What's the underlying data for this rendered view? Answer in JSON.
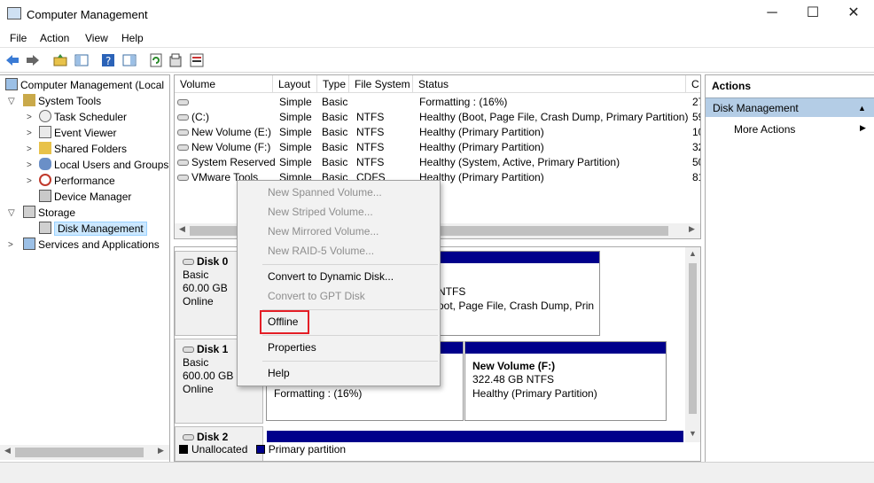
{
  "window": {
    "title": "Computer Management",
    "min": "─",
    "max": "☐",
    "close": "✕"
  },
  "menu": [
    "File",
    "Action",
    "View",
    "Help"
  ],
  "tree": {
    "root": "Computer Management (Local",
    "system_tools": "System Tools",
    "task_scheduler": "Task Scheduler",
    "event_viewer": "Event Viewer",
    "shared_folders": "Shared Folders",
    "local_users": "Local Users and Groups",
    "performance": "Performance",
    "device_manager": "Device Manager",
    "storage": "Storage",
    "disk_management": "Disk Management",
    "services": "Services and Applications"
  },
  "volume_list": {
    "columns": [
      "Volume",
      "Layout",
      "Type",
      "File System",
      "Status",
      "C"
    ],
    "rows": [
      {
        "volume": "",
        "layout": "Simple",
        "type": "Basic",
        "fs": "",
        "status": "Formatting : (16%)",
        "cap": "27"
      },
      {
        "volume": "(C:)",
        "layout": "Simple",
        "type": "Basic",
        "fs": "NTFS",
        "status": "Healthy (Boot, Page File, Crash Dump, Primary Partition)",
        "cap": "59"
      },
      {
        "volume": "New Volume (E:)",
        "layout": "Simple",
        "type": "Basic",
        "fs": "NTFS",
        "status": "Healthy (Primary Partition)",
        "cap": "10"
      },
      {
        "volume": "New Volume (F:)",
        "layout": "Simple",
        "type": "Basic",
        "fs": "NTFS",
        "status": "Healthy (Primary Partition)",
        "cap": "32"
      },
      {
        "volume": "System Reserved",
        "layout": "Simple",
        "type": "Basic",
        "fs": "NTFS",
        "status": "Healthy (System, Active, Primary Partition)",
        "cap": "50"
      },
      {
        "volume": "VMware Tools",
        "layout": "Simple",
        "type": "Basic",
        "fs": "CDFS",
        "status": "Healthy (Primary Partition)",
        "cap": "81"
      }
    ]
  },
  "disks": {
    "disk0": {
      "name": "Disk 0",
      "type": "Basic",
      "size": "60.00 GB",
      "state": "Online",
      "p_fs": "NTFS",
      "p_status": "oot, Page File, Crash Dump, Prin"
    },
    "disk1": {
      "name": "Disk 1",
      "type": "Basic",
      "size": "600.00 GB",
      "state": "Online",
      "p1_status": "Formatting : (16%)",
      "p2_name": "New Volume  (F:)",
      "p2_fs": "322.48 GB NTFS",
      "p2_status": "Healthy (Primary Partition)"
    },
    "disk2": {
      "name": "Disk 2"
    }
  },
  "legend": {
    "unallocated": "Unallocated",
    "primary": "Primary partition"
  },
  "actions": {
    "header": "Actions",
    "section": "Disk Management",
    "more": "More Actions"
  },
  "context_menu": {
    "new_spanned": "New Spanned Volume...",
    "new_striped": "New Striped Volume...",
    "new_mirrored": "New Mirrored Volume...",
    "new_raid5": "New RAID-5 Volume...",
    "convert_dynamic": "Convert to Dynamic Disk...",
    "convert_gpt": "Convert to GPT Disk",
    "offline": "Offline",
    "properties": "Properties",
    "help": "Help"
  },
  "colors": {
    "primary_partition": "#00008b",
    "unallocated": "#000000",
    "selection": "#cce8ff",
    "highlight_box": "#e41e26"
  }
}
